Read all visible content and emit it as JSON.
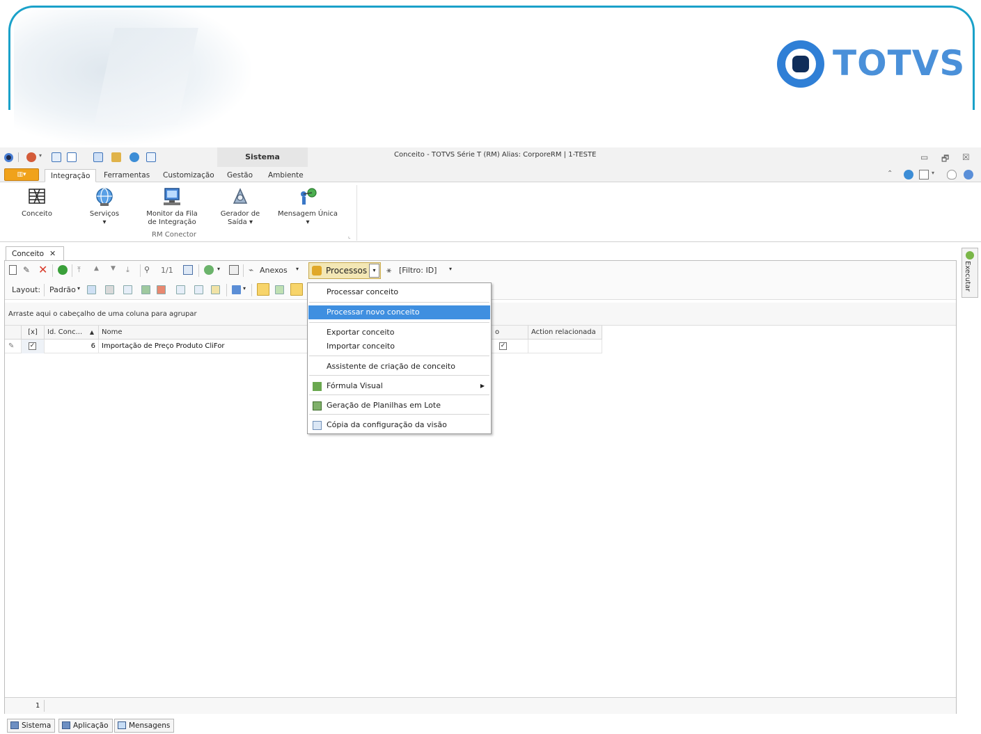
{
  "banner": {
    "brand": "TOTVS"
  },
  "titlebar": {
    "ribbon_context": "Sistema",
    "window_title": "Conceito - TOTVS Série T  (RM) Alias: CorporeRM | 1-TESTE",
    "minimize_glyph": "▭",
    "restore_glyph": "🗗",
    "close_glyph": "☒"
  },
  "ribbon": {
    "file_glyph": "▥▾",
    "tabs": [
      "Integração",
      "Ferramentas",
      "Customização",
      "Gestão",
      "Ambiente"
    ],
    "active_tab": "Integração",
    "buttons": [
      {
        "label": "Conceito",
        "icon": "concept-grid-icon"
      },
      {
        "label": "Serviços",
        "sub": "▾",
        "icon": "globe-service-icon"
      },
      {
        "label": "Monitor da Fila",
        "label2": "de Integração",
        "icon": "monitor-queue-icon"
      },
      {
        "label": "Gerador de",
        "label2": "Saída ▾",
        "icon": "output-generator-icon"
      },
      {
        "label": "Mensagem Única",
        "sub": "▾",
        "icon": "single-message-icon"
      }
    ],
    "group_label": "RM Conector",
    "launcher_glyph": "⌞"
  },
  "document": {
    "tab_label": "Conceito",
    "close_glyph": "✕",
    "toolbar": {
      "record_info": "1/1",
      "anexos_label": "Anexos",
      "processos_label": "Processos",
      "dropdown_glyph": "▾",
      "filter_label": "[Filtro: ID]"
    },
    "toolbar2": {
      "layout_label": "Layout:",
      "layout_value": "Padrão"
    },
    "groupby_hint": "Arraste aqui o cabeçalho de uma coluna para agrupar",
    "grid": {
      "columns": [
        "[x]",
        "Id. Conc...",
        "Nome",
        "o",
        "Action relacionada"
      ],
      "sort_glyph": "▲",
      "rows": [
        {
          "checked": "✓",
          "id": "6",
          "nome": "Importação de Preço Produto CliFor",
          "ativo": "✓",
          "action": ""
        }
      ],
      "row_count": "1"
    }
  },
  "executar_label": "Executar",
  "menu": {
    "items": [
      {
        "label": "Processar conceito"
      },
      {
        "label": "Processar novo conceito",
        "selected": true
      },
      {
        "label": "Exportar conceito"
      },
      {
        "label": "Importar conceito"
      },
      {
        "label": "Assistente de criação de conceito"
      },
      {
        "label": "Fórmula Visual",
        "submenu_glyph": "▶"
      },
      {
        "label": "Geração de Planilhas em Lote"
      },
      {
        "label": "Cópia da configuração da visão"
      }
    ]
  },
  "bottom_tabs": [
    "Sistema",
    "Aplicação",
    "Mensagens"
  ],
  "colors": {
    "accent": "#3f8fe0",
    "banner_border": "#1aa1c9",
    "file_button": "#f0a21b",
    "processos_highlight": "#f3e7b5"
  }
}
